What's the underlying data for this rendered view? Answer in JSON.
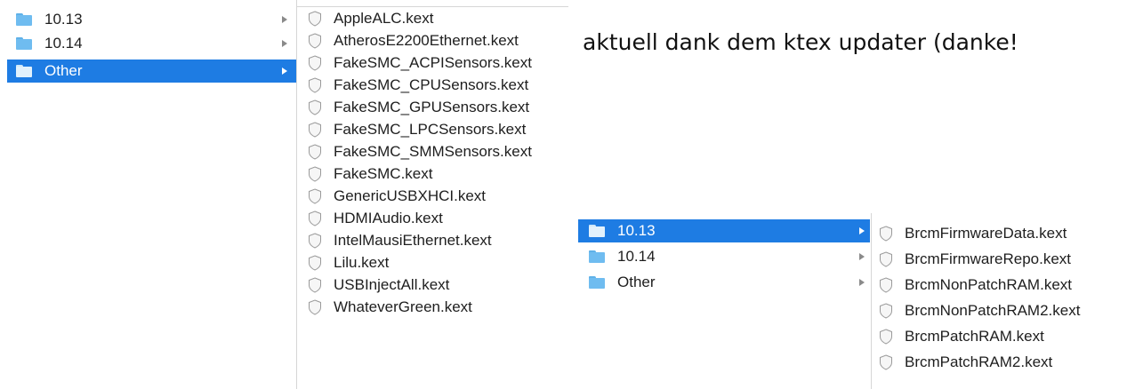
{
  "left_browser": {
    "folders": [
      {
        "label": "10.13",
        "selected": false
      },
      {
        "label": "10.14",
        "selected": false
      },
      {
        "label": "Other",
        "selected": true
      }
    ],
    "kexts": [
      "AppleALC.kext",
      "AtherosE2200Ethernet.kext",
      "FakeSMC_ACPISensors.kext",
      "FakeSMC_CPUSensors.kext",
      "FakeSMC_GPUSensors.kext",
      "FakeSMC_LPCSensors.kext",
      "FakeSMC_SMMSensors.kext",
      "FakeSMC.kext",
      "GenericUSBXHCI.kext",
      "HDMIAudio.kext",
      "IntelMausiEthernet.kext",
      "Lilu.kext",
      "USBInjectAll.kext",
      "WhateverGreen.kext"
    ]
  },
  "note": {
    "text": "aktuell dank dem ktex updater (danke!"
  },
  "right_browser": {
    "folders": [
      {
        "label": "10.13",
        "selected": true
      },
      {
        "label": "10.14",
        "selected": false
      },
      {
        "label": "Other",
        "selected": false
      }
    ],
    "kexts": [
      "BrcmFirmwareData.kext",
      "BrcmFirmwareRepo.kext",
      "BrcmNonPatchRAM.kext",
      "BrcmNonPatchRAM2.kext",
      "BrcmPatchRAM.kext",
      "BrcmPatchRAM2.kext"
    ]
  },
  "colors": {
    "selection": "#1e7ce3",
    "folder": "#6fbcf0",
    "separator": "#d6d6d6"
  },
  "icons": {
    "folder": "folder-icon",
    "disclosure": "disclosure-arrow-icon",
    "kext": "kext-shield-icon"
  }
}
